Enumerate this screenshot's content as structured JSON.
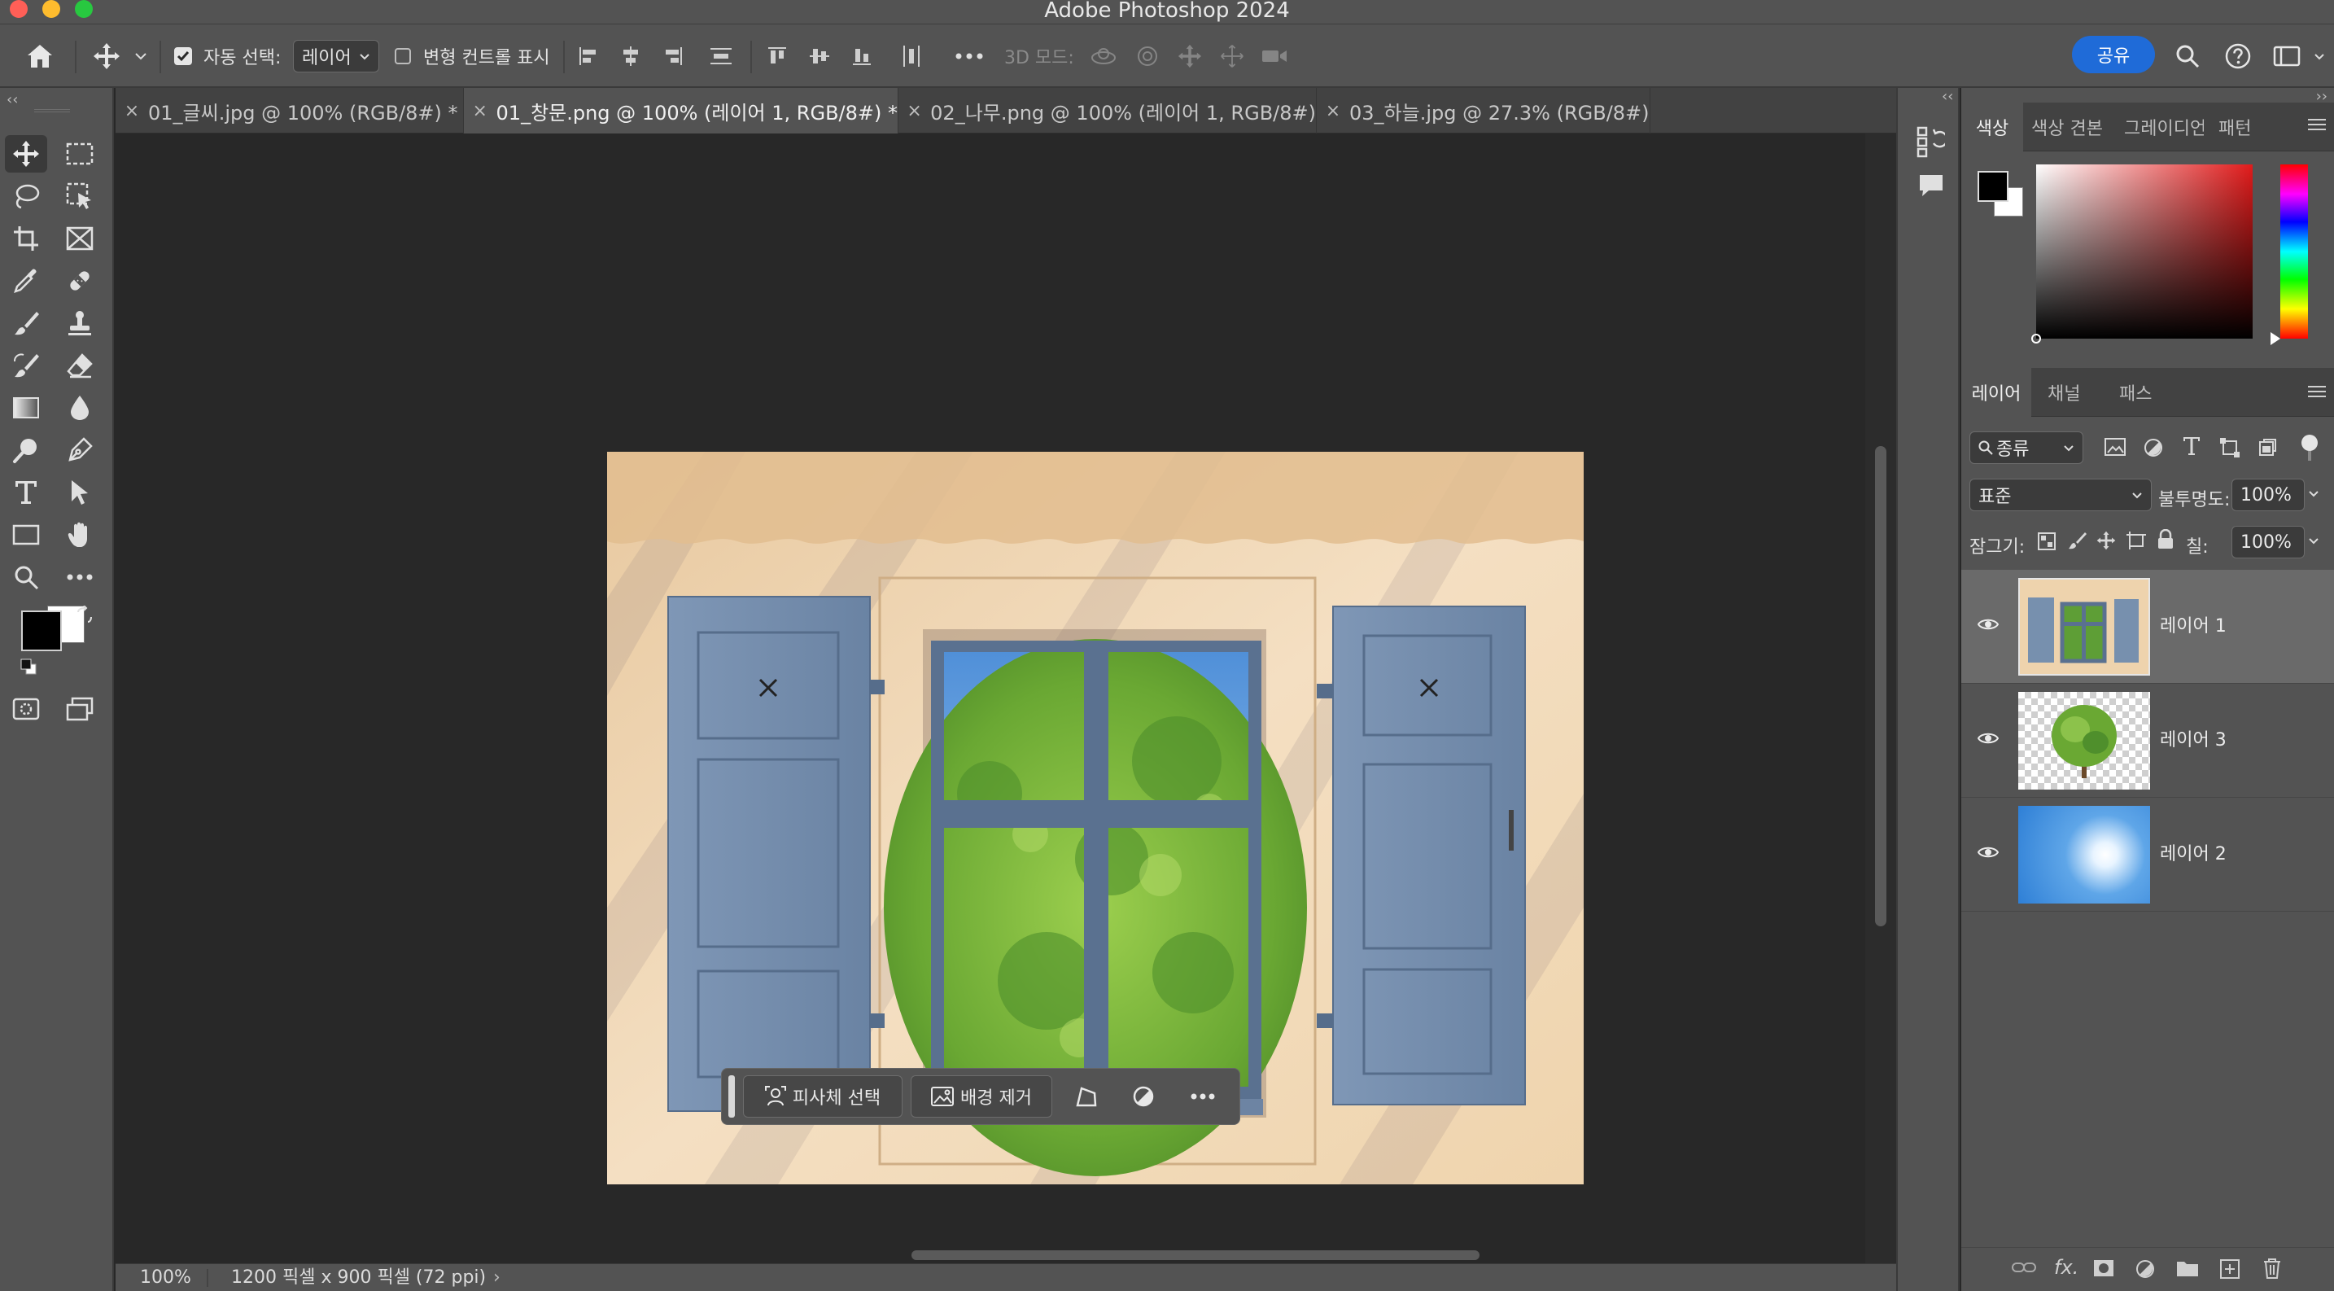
{
  "app": {
    "title": "Adobe Photoshop 2024"
  },
  "colors": {
    "accent": "#1f6bd8",
    "traffic_close": "#ff5f57",
    "traffic_min": "#febc2e",
    "traffic_max": "#28c840"
  },
  "options": {
    "auto_select_label": "자동 선택:",
    "auto_select_value": "레이어",
    "show_transform_label": "변형 컨트롤 표시",
    "mode_3d_label": "3D 모드:",
    "share_label": "공유"
  },
  "tabs": [
    {
      "label": "01_글씨.jpg @ 100% (RGB/8#) *"
    },
    {
      "label": "01_창문.png @ 100% (레이어 1, RGB/8#) *"
    },
    {
      "label": "02_나무.png @ 100% (레이어 1, RGB/8#)"
    },
    {
      "label": "03_하늘.jpg @ 27.3% (RGB/8#)"
    }
  ],
  "task_bar": {
    "select_subject_label": "피사체 선택",
    "remove_bg_label": "배경 제거"
  },
  "status": {
    "zoom": "100%",
    "doc_info": "1200 픽셀 x 900 픽셀 (72 ppi)"
  },
  "color_panel": {
    "tabs": [
      "색상",
      "색상 견본",
      "그레이디언",
      "패턴"
    ]
  },
  "layers_panel": {
    "tabs": [
      "레이어",
      "채널",
      "패스"
    ],
    "filter_kind": "종류",
    "blend_mode": "표준",
    "opacity_label": "불투명도:",
    "opacity_value": "100%",
    "lock_label": "잠그기:",
    "fill_label": "칠:",
    "fill_value": "100%",
    "layers": [
      {
        "name": "레이어 1",
        "thumb": "window",
        "selected": true
      },
      {
        "name": "레이어 3",
        "thumb": "tree",
        "selected": false
      },
      {
        "name": "레이어 2",
        "thumb": "sky",
        "selected": false
      }
    ]
  }
}
